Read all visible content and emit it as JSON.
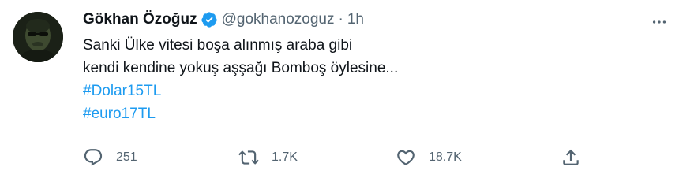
{
  "author": {
    "display_name": "Gökhan Özoğuz",
    "handle": "@gokhanozoguz",
    "separator": "·",
    "time": "1h",
    "verified": true
  },
  "tweet": {
    "lines": [
      "Sanki Ülke vitesi boşa alınmış araba gibi",
      "kendi kendine yokuş aşşağı Bomboş öylesine..."
    ],
    "hashtags": [
      "#Dolar15TL",
      "#euro17TL"
    ]
  },
  "actions": {
    "reply": {
      "icon": "reply-icon",
      "count": "251"
    },
    "retweet": {
      "icon": "retweet-icon",
      "count": "1.7K"
    },
    "like": {
      "icon": "heart-icon",
      "count": "18.7K"
    },
    "share": {
      "icon": "share-icon"
    }
  },
  "colors": {
    "accent": "#1d9bf0",
    "text": "#0f1419",
    "muted": "#536471"
  }
}
